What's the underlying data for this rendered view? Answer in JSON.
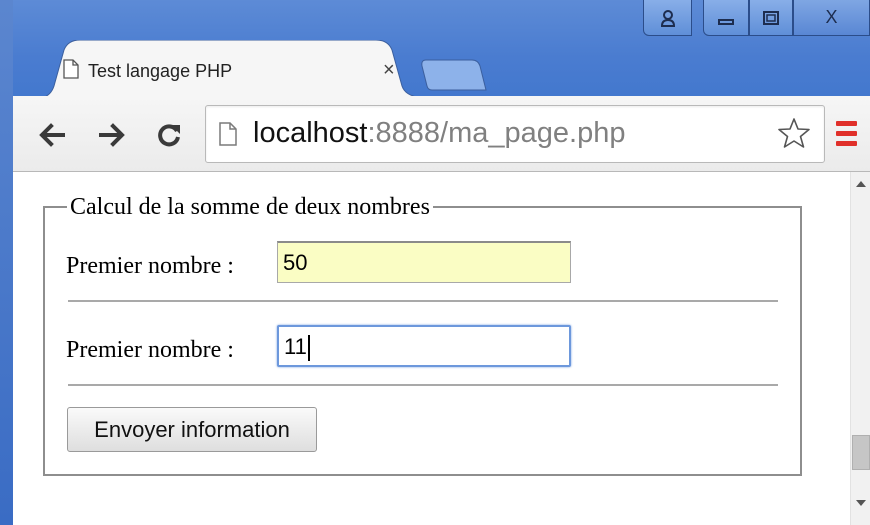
{
  "window": {
    "controls": {
      "user_icon": "user-profile-icon",
      "minimize_icon": "minimize-icon",
      "maximize_icon": "maximize-icon",
      "close_label": "X"
    },
    "colors": {
      "titlebar": "#4a7cd0",
      "frame": "#3a6cc4"
    }
  },
  "tab": {
    "title": "Test langage PHP",
    "close_label": "×",
    "icon": "page-icon"
  },
  "toolbar": {
    "back_icon": "back-arrow-icon",
    "forward_icon": "forward-arrow-icon",
    "reload_icon": "reload-icon",
    "url_host": "localhost",
    "url_rest": ":8888/ma_page.php",
    "bookmark_icon": "star-icon",
    "menu_icon": "menu-icon"
  },
  "form": {
    "legend": "Calcul de la somme de deux nombres",
    "field1": {
      "label": "Premier nombre :",
      "value": "50",
      "highlight": "#fafdc4"
    },
    "field2": {
      "label": "Premier nombre :",
      "value": "11",
      "focused": true
    },
    "submit_label": "Envoyer information"
  }
}
